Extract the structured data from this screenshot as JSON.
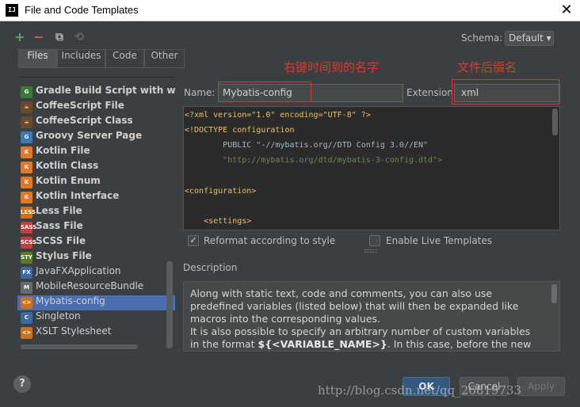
{
  "window": {
    "title": "File and Code Templates",
    "app_icon": "IJ",
    "close": "✕"
  },
  "toolbar": {
    "add": "+",
    "remove": "−",
    "copy": "⧉",
    "reset": "⟲"
  },
  "schema": {
    "label": "Schema:",
    "value": "Default ▾"
  },
  "tabs": [
    {
      "label": "Files"
    },
    {
      "label": "Includes"
    },
    {
      "label": "Code"
    },
    {
      "label": "Other"
    }
  ],
  "templates": [
    {
      "label": "Gradle Build Script with wrap",
      "bold": true,
      "icon": "G",
      "color": "#3c7a3a"
    },
    {
      "label": "CoffeeScript File",
      "bold": true,
      "icon": "☕",
      "color": "#6a4a2a"
    },
    {
      "label": "CoffeeScript Class",
      "bold": true,
      "icon": "☕",
      "color": "#6a4a2a"
    },
    {
      "label": "Groovy Server Page",
      "bold": true,
      "icon": "G",
      "color": "#3a7ab0"
    },
    {
      "label": "Kotlin File",
      "bold": true,
      "icon": "K",
      "color": "#e07a2a"
    },
    {
      "label": "Kotlin Class",
      "bold": true,
      "icon": "K",
      "color": "#e07a2a"
    },
    {
      "label": "Kotlin Enum",
      "bold": true,
      "icon": "K",
      "color": "#e07a2a"
    },
    {
      "label": "Kotlin Interface",
      "bold": true,
      "icon": "K",
      "color": "#e07a2a"
    },
    {
      "label": "Less File",
      "bold": true,
      "icon": "LESS",
      "color": "#c7731f"
    },
    {
      "label": "Sass File",
      "bold": true,
      "icon": "SASS",
      "color": "#c04040"
    },
    {
      "label": "SCSS File",
      "bold": true,
      "icon": "SCSS",
      "color": "#c04040"
    },
    {
      "label": "Stylus File",
      "bold": true,
      "icon": "STY",
      "color": "#5a7a2a"
    },
    {
      "label": "JavaFXApplication",
      "bold": false,
      "icon": "FX",
      "color": "#3a6aa0"
    },
    {
      "label": "MobileResourceBundle",
      "bold": false,
      "icon": "M",
      "color": "#6a6a6a"
    },
    {
      "label": "Mybatis-config",
      "bold": false,
      "icon": "<>",
      "color": "#c7731f",
      "selected": true
    },
    {
      "label": "Singleton",
      "bold": false,
      "icon": "C",
      "color": "#3a6aa0"
    },
    {
      "label": "XSLT Stylesheet",
      "bold": false,
      "icon": "<>",
      "color": "#c7731f"
    }
  ],
  "form": {
    "name_label": "Name:",
    "name_value": "Mybatis-config",
    "ext_label": "Extension:",
    "ext_value": "xml"
  },
  "annotations": {
    "name": "右键时间到的名字",
    "ext": "文件后缀名"
  },
  "code_lines": [
    {
      "text": "<?xml version=\"1.0\" encoding=\"UTF-8\" ?>"
    },
    {
      "text": "<!DOCTYPE configuration"
    },
    {
      "text": "        PUBLIC \"-//mybatis.org//DTD Config 3.0//EN\""
    },
    {
      "text": "        \"http://mybatis.org/dtd/mybatis-3-config.dtd\">"
    },
    {
      "text": ""
    },
    {
      "text": "<configuration>"
    },
    {
      "text": ""
    },
    {
      "text": "    <settings>"
    }
  ],
  "options": {
    "reformat": {
      "label": "Reformat according to style",
      "checked": true
    },
    "live": {
      "label": "Enable Live Templates",
      "checked": false
    }
  },
  "description": {
    "title": "Description",
    "line1": "Along with static text, code and comments, you can also use",
    "line2": "predefined variables (listed below) that will then be expanded like",
    "line3": "macros into the corresponding values.",
    "line4": "It is also possible to specify an arbitrary number of custom variables",
    "line5a": "in the format ",
    "line5b": "${<VARIABLE_NAME>}",
    "line5c": ". In this case, before the new"
  },
  "buttons": {
    "help": "?",
    "ok": "OK",
    "cancel": "Cancel",
    "apply": "Apply"
  },
  "watermark": "http://blog.csdn.net/qq_26819733"
}
